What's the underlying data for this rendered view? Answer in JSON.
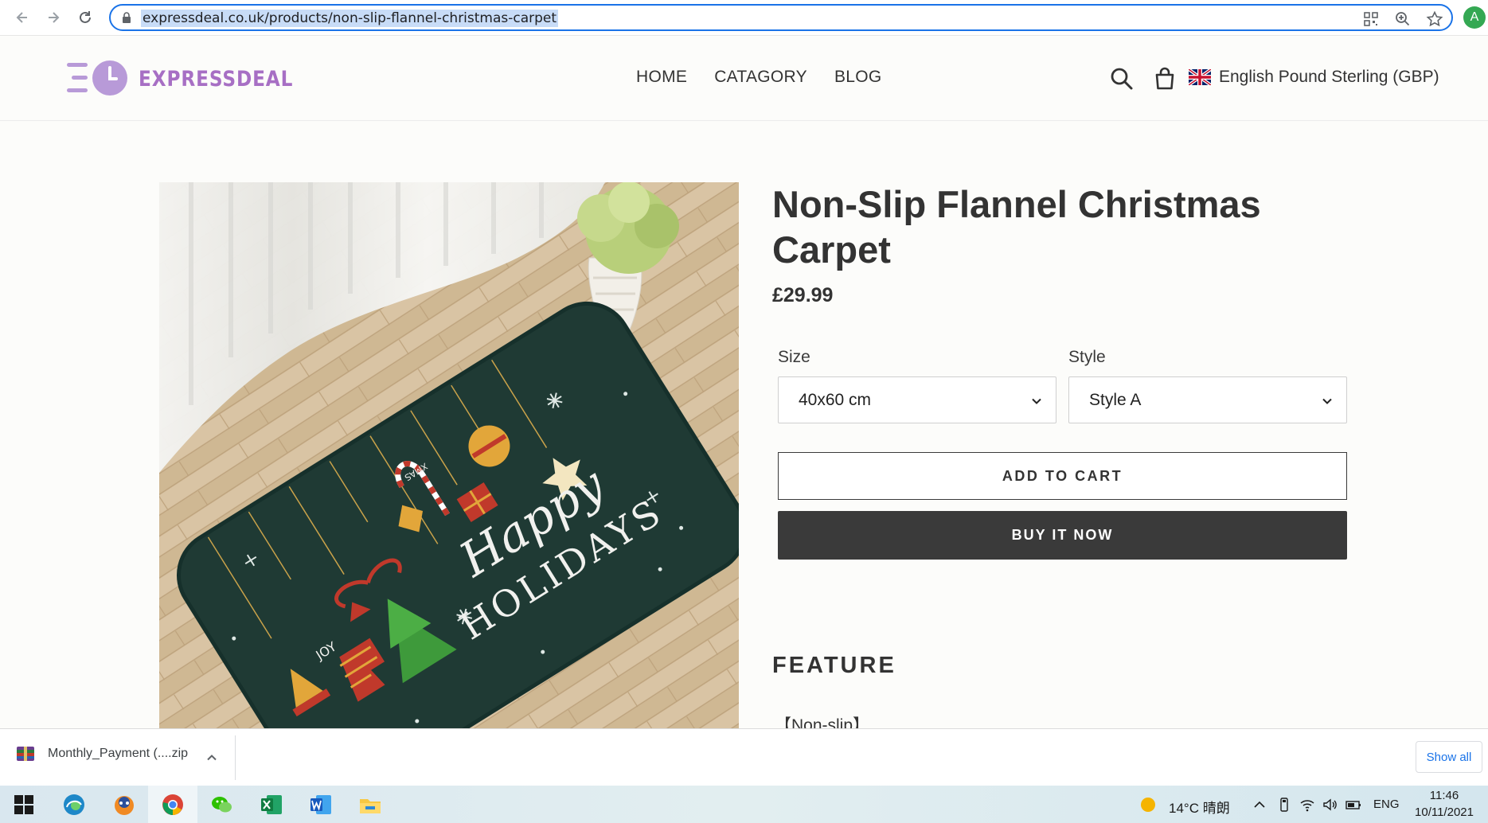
{
  "browser": {
    "url": "expressdeal.co.uk/products/non-slip-flannel-christmas-carpet",
    "profile_initial": "A",
    "icons": [
      "back-icon",
      "forward-icon",
      "reload-icon",
      "lock-icon",
      "qr-code-icon",
      "zoom-icon",
      "bookmark-star-icon"
    ]
  },
  "site": {
    "logo_text": "EXPRESSDEAL",
    "nav": [
      {
        "label": "HOME"
      },
      {
        "label": "CATAGORY"
      },
      {
        "label": "BLOG"
      }
    ],
    "currency_label": "English Pound Sterling (GBP)",
    "brand_color": "#a76fc4"
  },
  "product": {
    "title": "Non-Slip Flannel Christmas Carpet",
    "price": "£29.99",
    "options": {
      "size_label": "Size",
      "size_value": "40x60 cm",
      "style_label": "Style",
      "style_value": "Style A"
    },
    "add_to_cart_label": "ADD TO CART",
    "buy_now_label": "BUY IT NOW",
    "feature_heading": "FEATURE",
    "feature_first_item": "【Non-slip】",
    "image_text": {
      "line1": "Happy",
      "line2": "HOLIDAYS",
      "joy": "JOY",
      "xmas": "XMAS"
    }
  },
  "downloads": {
    "file_name": "Monthly_Payment (....zip",
    "show_all_label": "Show all"
  },
  "taskbar": {
    "weather": "14°C  晴朗",
    "language": "ENG",
    "time": "11:46",
    "date": "10/11/2021"
  }
}
